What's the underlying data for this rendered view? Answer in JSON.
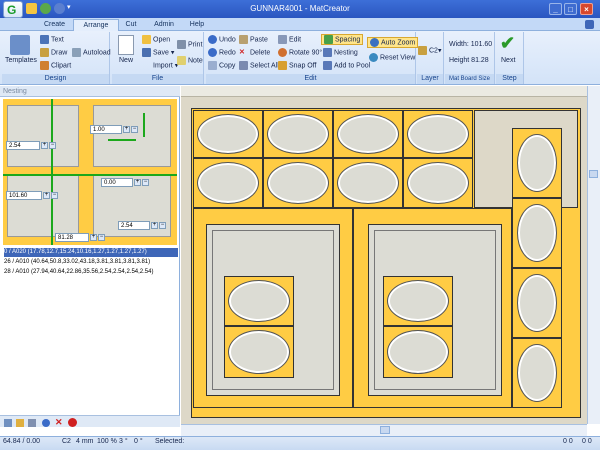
{
  "window": {
    "title": "GUNNAR4001 - MatCreator",
    "app_logo_letter": "G",
    "quick_access_icons": [
      "folder-icon",
      "undo-icon",
      "redo-icon",
      "dropdown-icon"
    ]
  },
  "tabs": [
    {
      "label": "Create",
      "active": false
    },
    {
      "label": "Arrange",
      "active": true
    },
    {
      "label": "Cut",
      "active": false
    },
    {
      "label": "Admin",
      "active": false
    },
    {
      "label": "Help",
      "active": false
    }
  ],
  "ribbon": {
    "design": {
      "label": "Design",
      "templates": "Templates",
      "text": "Text",
      "draw": "Draw",
      "autoload": "Autoload",
      "clipart": "Clipart"
    },
    "file": {
      "label": "File",
      "new": "New",
      "open": "Open",
      "save": "Save",
      "import": "Import",
      "print": "Print",
      "note": "Note"
    },
    "edit": {
      "label": "Edit",
      "undo": "Undo",
      "paste": "Paste",
      "edit": "Edit",
      "spacing": "Spacing",
      "auto_zoom": "Auto Zoom",
      "redo": "Redo",
      "delete": "Delete",
      "rotate": "Rotate 90°",
      "nesting": "Nesting",
      "reset_view": "Reset View",
      "copy": "Copy",
      "select_all": "Select All",
      "snap_off": "Snap Off",
      "add_to_pool": "Add to Pool"
    },
    "layer": {
      "label": "Layer",
      "value": "C2"
    },
    "mat_board": {
      "label": "Mat Board Size",
      "width": "Width: 101.60",
      "height": "Height 81.28"
    },
    "step": {
      "label": "Step",
      "next": "Next"
    }
  },
  "panel": {
    "title": "Nesting",
    "inputs": {
      "top_right": "1.00",
      "left_margin": "2.54",
      "mid_right": "0.00",
      "width": "101.60",
      "bottom_right": "2.54",
      "height": "81.28"
    },
    "list": [
      {
        "text": "0 / A020 (17.78,12.7,15.24,10.16,1.27,1.27,1.27,1.27)",
        "selected": true
      },
      {
        "text": "26 / A010 (40.64,50.8,33.02,43.18,3.81,3.81,3.81,3.81)",
        "selected": false
      },
      {
        "text": "28 / A010 (27.94,40.64,22.86,35.56,2.54,2.54,2.54,2.54)",
        "selected": false
      }
    ]
  },
  "status": {
    "coords": "64.84 / 0.00",
    "layer": "C2",
    "unit": "4 mm",
    "zoom": "100 %",
    "angle": "3 °",
    "offset": "0 °",
    "selected": "Selected:",
    "right_a": "0 0",
    "right_b": "0 0"
  },
  "colors": {
    "mat": "#ffcc44",
    "opening": "#dcdcd4",
    "title_bar": "#2a56c0",
    "selection": "#3e66b8"
  }
}
